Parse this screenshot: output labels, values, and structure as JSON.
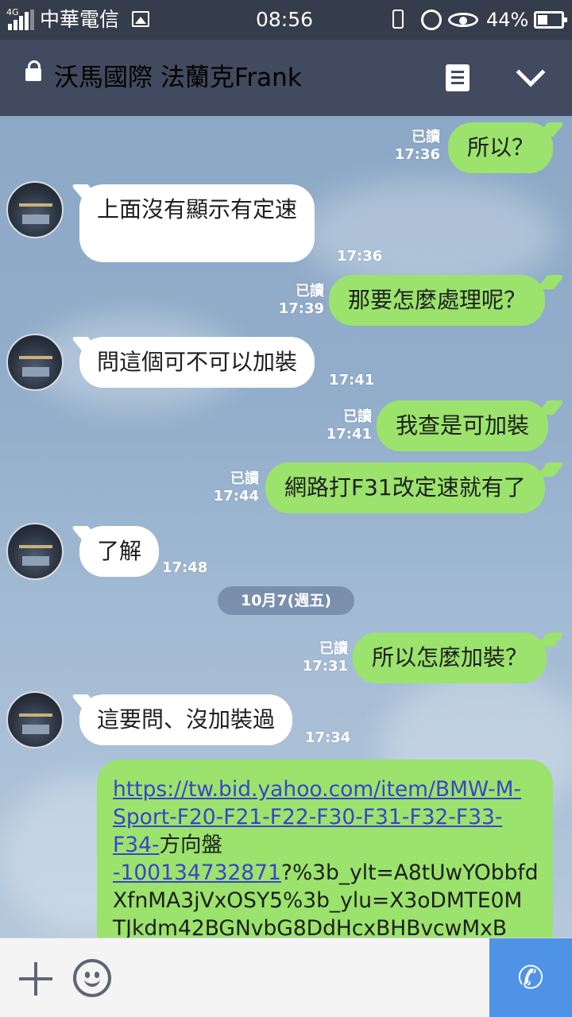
{
  "status_bar": {
    "network": "4G",
    "carrier": "中華電信",
    "time": "08:56",
    "battery_pct": "44%",
    "battery_level": 0.44,
    "icons": [
      "signal-icon",
      "image-icon",
      "vibrate-icon",
      "alarm-icon",
      "eye-icon",
      "battery-icon"
    ]
  },
  "header": {
    "title": "沃馬國際 法蘭克Frank",
    "icons": [
      "lock-icon",
      "notes-icon",
      "chevron-down-icon"
    ]
  },
  "messages": [
    {
      "dir": "out",
      "text": "所以？",
      "read": "已讀",
      "time": "17:36"
    },
    {
      "dir": "in",
      "text": "上面沒有顯示有定速",
      "time": "17:36"
    },
    {
      "dir": "out",
      "text": "那要怎麼處理呢？",
      "read": "已讀",
      "time": "17:39"
    },
    {
      "dir": "in",
      "text": "問這個可不可以加裝",
      "time": "17:41"
    },
    {
      "dir": "out",
      "text": "我查是可加裝",
      "read": "已讀",
      "time": "17:41"
    },
    {
      "dir": "out",
      "text": "網路打F31改定速就有了",
      "read": "已讀",
      "time": "17:44"
    },
    {
      "dir": "in",
      "text": "了解",
      "time": "17:48"
    },
    {
      "dir": "out",
      "text": "所以怎麼加裝？",
      "read": "已讀",
      "time": "17:31"
    },
    {
      "dir": "in",
      "text": "這要問、沒加裝過",
      "time": "17:34"
    }
  ],
  "date_separator": "10月7(週五)",
  "link_message": {
    "url_part1": "https://tw.bid.yahoo.com/item/BMW-M-",
    "url_part2": "Sport-F20-F21-F22-F30-F31-F32-F33-",
    "url_part3": "F34-",
    "text_mid": "方向盤",
    "url_part4": "-100134732871",
    "tail1": "?%3b_ylt=A8tUwYObbfd",
    "tail2": "XfnMA3jVxOSY5%3b_ylu=X3oDMTE0M",
    "tail3": "TJkdm42BGNvbG8DdHcxBHBvcwMxB"
  },
  "input_bar": {
    "icons": [
      "plus-icon",
      "emoji-icon",
      "phone-icon"
    ]
  },
  "colors": {
    "header_bg": "#414a5e",
    "status_bg": "#353c4b",
    "outgoing_bubble": "#9be36d",
    "incoming_bubble": "#ffffff",
    "call_button": "#4f93e6",
    "link": "#3b44c9"
  }
}
